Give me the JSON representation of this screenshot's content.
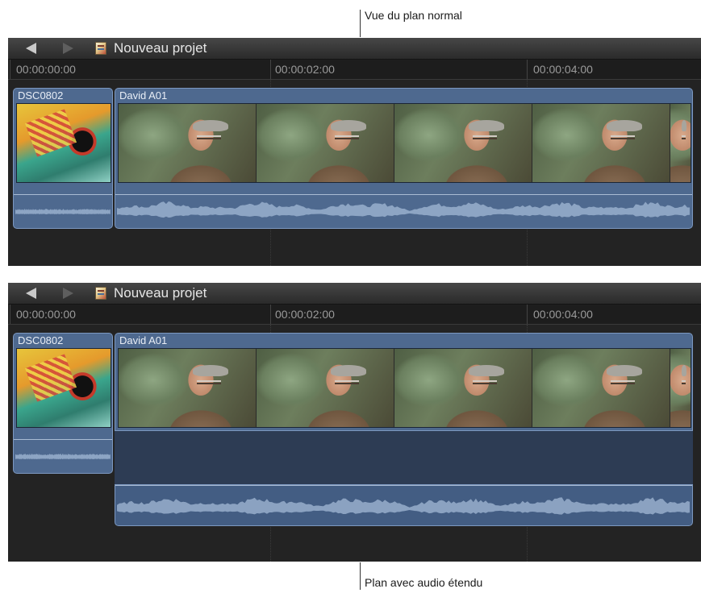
{
  "annotations": {
    "top": "Vue du plan normal",
    "bottom": "Plan avec audio étendu"
  },
  "timeline": {
    "project_title": "Nouveau projet",
    "timecodes": [
      "00:00:00:00",
      "00:00:02:00",
      "00:00:04:00"
    ]
  },
  "clips": {
    "still": {
      "name": "DSC0802"
    },
    "video": {
      "name": "David A01"
    }
  },
  "icons": {
    "back": "triangle-left-icon",
    "forward": "triangle-right-icon",
    "project": "project-clapper-icon"
  },
  "colors": {
    "clip_fill": "#4e698f",
    "clip_border": "#7c98c0",
    "timeline_bg": "#232323",
    "waveform": "#9eb4d1"
  }
}
